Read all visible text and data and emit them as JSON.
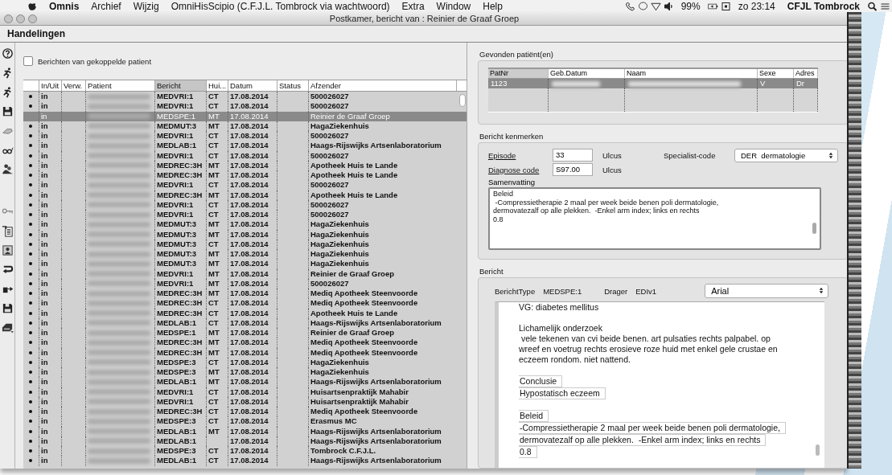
{
  "menu_bar": {
    "app": "Omnis",
    "items": [
      "Archief",
      "Wijzig",
      "OmniHisScipio (C.F.J.L. Tombrock via wachtwoord)",
      "Extra",
      "Window",
      "Help"
    ],
    "battery": "99%",
    "clock": "zo 23:14",
    "user": "CFJL Tombrock"
  },
  "window": {
    "title": "Postkamer, bericht van : Reinier de Graaf Groep",
    "toolbar_label": "Handelingen"
  },
  "message_list": {
    "filter": {
      "label": "Berichten van gekoppelde patient",
      "checked": false
    },
    "columns": [
      {
        "sorted": false
      },
      {
        "label": "In/Uit",
        "sorted": false
      },
      {
        "label": "Verw.",
        "sorted": false
      },
      {
        "label": "Patient",
        "sorted": false
      },
      {
        "label": "Bericht",
        "sorted": true
      },
      {
        "label": "Hui...",
        "sorted": false
      },
      {
        "label": "Datum",
        "sorted": false
      },
      {
        "label": "Status",
        "sorted": false
      },
      {
        "label": "Afzender",
        "sorted": false
      }
    ],
    "rows": [
      {
        "marked": true,
        "direction": "in",
        "message": "MEDVRI:1",
        "hui": "CT",
        "date": "17.08.2014",
        "sender": "500026027",
        "selected": false
      },
      {
        "marked": true,
        "direction": "in",
        "message": "MEDVRI:1",
        "hui": "CT",
        "date": "17.08.2014",
        "sender": "500026027",
        "selected": false
      },
      {
        "marked": false,
        "direction": "in",
        "message": "MEDSPE:1",
        "hui": "MT",
        "date": "17.08.2014",
        "sender": "Reinier de Graaf Groep",
        "selected": true
      },
      {
        "marked": true,
        "direction": "in",
        "message": "MEDMUT:3",
        "hui": "MT",
        "date": "17.08.2014",
        "sender": "HagaZiekenhuis",
        "selected": false
      },
      {
        "marked": true,
        "direction": "in",
        "message": "MEDVRI:1",
        "hui": "CT",
        "date": "17.08.2014",
        "sender": "500026027",
        "selected": false
      },
      {
        "marked": true,
        "direction": "in",
        "message": "MEDLAB:1",
        "hui": "CT",
        "date": "17.08.2014",
        "sender": "Haags-Rijswijks Artsenlaboratorium",
        "selected": false
      },
      {
        "marked": true,
        "direction": "in",
        "message": "MEDVRI:1",
        "hui": "CT",
        "date": "17.08.2014",
        "sender": "500026027",
        "selected": false
      },
      {
        "marked": true,
        "direction": "in",
        "message": "MEDREC:3H",
        "hui": "MT",
        "date": "17.08.2014",
        "sender": "Apotheek Huis te Lande",
        "selected": false
      },
      {
        "marked": true,
        "direction": "in",
        "message": "MEDREC:3H",
        "hui": "MT",
        "date": "17.08.2014",
        "sender": "Apotheek Huis te Lande",
        "selected": false
      },
      {
        "marked": true,
        "direction": "in",
        "message": "MEDVRI:1",
        "hui": "CT",
        "date": "17.08.2014",
        "sender": "500026027",
        "selected": false
      },
      {
        "marked": true,
        "direction": "in",
        "message": "MEDREC:3H",
        "hui": "MT",
        "date": "17.08.2014",
        "sender": "Apotheek Huis te Lande",
        "selected": false
      },
      {
        "marked": true,
        "direction": "in",
        "message": "MEDVRI:1",
        "hui": "CT",
        "date": "17.08.2014",
        "sender": "500026027",
        "selected": false
      },
      {
        "marked": true,
        "direction": "in",
        "message": "MEDVRI:1",
        "hui": "CT",
        "date": "17.08.2014",
        "sender": "500026027",
        "selected": false
      },
      {
        "marked": true,
        "direction": "in",
        "message": "MEDMUT:3",
        "hui": "MT",
        "date": "17.08.2014",
        "sender": "HagaZiekenhuis",
        "selected": false
      },
      {
        "marked": true,
        "direction": "in",
        "message": "MEDMUT:3",
        "hui": "MT",
        "date": "17.08.2014",
        "sender": "HagaZiekenhuis",
        "selected": false
      },
      {
        "marked": true,
        "direction": "in",
        "message": "MEDMUT:3",
        "hui": "CT",
        "date": "17.08.2014",
        "sender": "HagaZiekenhuis",
        "selected": false
      },
      {
        "marked": true,
        "direction": "in",
        "message": "MEDMUT:3",
        "hui": "MT",
        "date": "17.08.2014",
        "sender": "HagaZiekenhuis",
        "selected": false
      },
      {
        "marked": true,
        "direction": "in",
        "message": "MEDMUT:3",
        "hui": "MT",
        "date": "17.08.2014",
        "sender": "HagaZiekenhuis",
        "selected": false
      },
      {
        "marked": true,
        "direction": "in",
        "message": "MEDVRI:1",
        "hui": "MT",
        "date": "17.08.2014",
        "sender": "Reinier de Graaf Groep",
        "selected": false
      },
      {
        "marked": true,
        "direction": "in",
        "message": "MEDVRI:1",
        "hui": "MT",
        "date": "17.08.2014",
        "sender": "500026027",
        "selected": false
      },
      {
        "marked": true,
        "direction": "in",
        "message": "MEDREC:3H",
        "hui": "MT",
        "date": "17.08.2014",
        "sender": "Mediq Apotheek Steenvoorde",
        "selected": false
      },
      {
        "marked": true,
        "direction": "in",
        "message": "MEDREC:3H",
        "hui": "CT",
        "date": "17.08.2014",
        "sender": "Mediq Apotheek Steenvoorde",
        "selected": false
      },
      {
        "marked": true,
        "direction": "in",
        "message": "MEDREC:3H",
        "hui": "CT",
        "date": "17.08.2014",
        "sender": "Apotheek Huis te Lande",
        "selected": false
      },
      {
        "marked": true,
        "direction": "in",
        "message": "MEDLAB:1",
        "hui": "CT",
        "date": "17.08.2014",
        "sender": "Haags-Rijswijks Artsenlaboratorium",
        "selected": false
      },
      {
        "marked": true,
        "direction": "in",
        "message": "MEDSPE:1",
        "hui": "MT",
        "date": "17.08.2014",
        "sender": "Reinier de Graaf Groep",
        "selected": false
      },
      {
        "marked": true,
        "direction": "in",
        "message": "MEDREC:3H",
        "hui": "MT",
        "date": "17.08.2014",
        "sender": "Mediq Apotheek Steenvoorde",
        "selected": false
      },
      {
        "marked": true,
        "direction": "in",
        "message": "MEDREC:3H",
        "hui": "MT",
        "date": "17.08.2014",
        "sender": "Mediq Apotheek Steenvoorde",
        "selected": false
      },
      {
        "marked": true,
        "direction": "in",
        "message": "MEDSPE:3",
        "hui": "CT",
        "date": "17.08.2014",
        "sender": "HagaZiekenhuis",
        "selected": false
      },
      {
        "marked": true,
        "direction": "in",
        "message": "MEDSPE:3",
        "hui": "MT",
        "date": "17.08.2014",
        "sender": "HagaZiekenhuis",
        "selected": false
      },
      {
        "marked": true,
        "direction": "in",
        "message": "MEDLAB:1",
        "hui": "MT",
        "date": "17.08.2014",
        "sender": "Haags-Rijswijks Artsenlaboratorium",
        "selected": false
      },
      {
        "marked": true,
        "direction": "in",
        "message": "MEDVRI:1",
        "hui": "CT",
        "date": "17.08.2014",
        "sender": "Huisartsenpraktijk Mahabir",
        "selected": false
      },
      {
        "marked": true,
        "direction": "in",
        "message": "MEDVRI:1",
        "hui": "CT",
        "date": "17.08.2014",
        "sender": "Huisartsenpraktijk Mahabir",
        "selected": false
      },
      {
        "marked": true,
        "direction": "in",
        "message": "MEDREC:3H",
        "hui": "CT",
        "date": "17.08.2014",
        "sender": "Mediq Apotheek Steenvoorde",
        "selected": false
      },
      {
        "marked": true,
        "direction": "in",
        "message": "MEDSPE:3",
        "hui": "CT",
        "date": "17.08.2014",
        "sender": "Erasmus MC",
        "selected": false
      },
      {
        "marked": true,
        "direction": "in",
        "message": "MEDLAB:1",
        "hui": "MT",
        "date": "17.08.2014",
        "sender": "Haags-Rijswijks Artsenlaboratorium",
        "selected": false
      },
      {
        "marked": true,
        "direction": "in",
        "message": "MEDLAB:1",
        "date": "17.08.2014",
        "sender": "Haags-Rijswijks Artsenlaboratorium",
        "selected": false
      },
      {
        "marked": true,
        "direction": "in",
        "message": "MEDSPE:3",
        "hui": "CT",
        "date": "17.08.2014",
        "sender": "Tombrock  C.F.J.L.",
        "selected": false
      },
      {
        "marked": true,
        "direction": "in",
        "message": "MEDLAB:1",
        "hui": "CT",
        "date": "17.08.2014",
        "sender": "Haags-Rijswijks Artsenlaboratorium",
        "selected": false
      }
    ]
  },
  "found_patients": {
    "title": "Gevonden patiënt(en)",
    "columns": [
      {
        "label": "PatNr",
        "sorted": true
      },
      {
        "label": "Geb.Datum",
        "sorted": false
      },
      {
        "label": "Naam",
        "sorted": false
      },
      {
        "label": "Sexe",
        "sorted": false
      },
      {
        "label": "Adres",
        "sorted": false
      }
    ],
    "rows": [
      {
        "patnr": "1123",
        "sexe": "V",
        "adres": "Dr",
        "selected": true
      }
    ]
  },
  "message_properties": {
    "title": "Bericht kenmerken",
    "episode": {
      "label": "Episode",
      "value": "33",
      "note": "Ulcus"
    },
    "diagnosis": {
      "label": "Diagnose code",
      "value": "S97.00",
      "note": "Ulcus"
    },
    "specialist": {
      "label": "Specialist-code",
      "value": "DER  dermatologie"
    },
    "summary": {
      "label": "Samenvatting",
      "lines": [
        "Beleid",
        " -Compressietherapie 2 maal per week beide benen poli dermatologie,",
        "dermovatezalf op alle plekken.  -Enkel arm index; links en rechts",
        "0.8"
      ]
    }
  },
  "message": {
    "title": "Bericht",
    "type_label": "BerichtType",
    "type": "MEDSPE:1",
    "carrier_label": "Drager",
    "carrier": "EDIv1",
    "font": "Arial",
    "body": [
      {
        "kind": "plain",
        "text": "VG: diabetes mellitus"
      },
      {
        "kind": "blank"
      },
      {
        "kind": "plain",
        "text": "Lichamelijk onderzoek"
      },
      {
        "kind": "plain",
        "text": " vele tekenen van cvi beide benen. art pulsaties rechts palpabel. op"
      },
      {
        "kind": "plain",
        "text": "wreef en voetrug rechts erosieve roze huid met enkel gele crustae en"
      },
      {
        "kind": "plain",
        "text": "eczeem rondom. niet nattend."
      },
      {
        "kind": "blank"
      },
      {
        "kind": "boxed",
        "text": "Conclusie"
      },
      {
        "kind": "boxed",
        "text": "Hypostatisch eczeem"
      },
      {
        "kind": "blank"
      },
      {
        "kind": "boxed",
        "text": "Beleid"
      },
      {
        "kind": "boxed",
        "text": "-Compressietherapie 2 maal per week beide benen poli dermatologie,"
      },
      {
        "kind": "boxed",
        "text": "dermovatezalf op alle plekken.  -Enkel arm index; links en rechts"
      },
      {
        "kind": "boxed",
        "text": "0.8"
      }
    ]
  }
}
